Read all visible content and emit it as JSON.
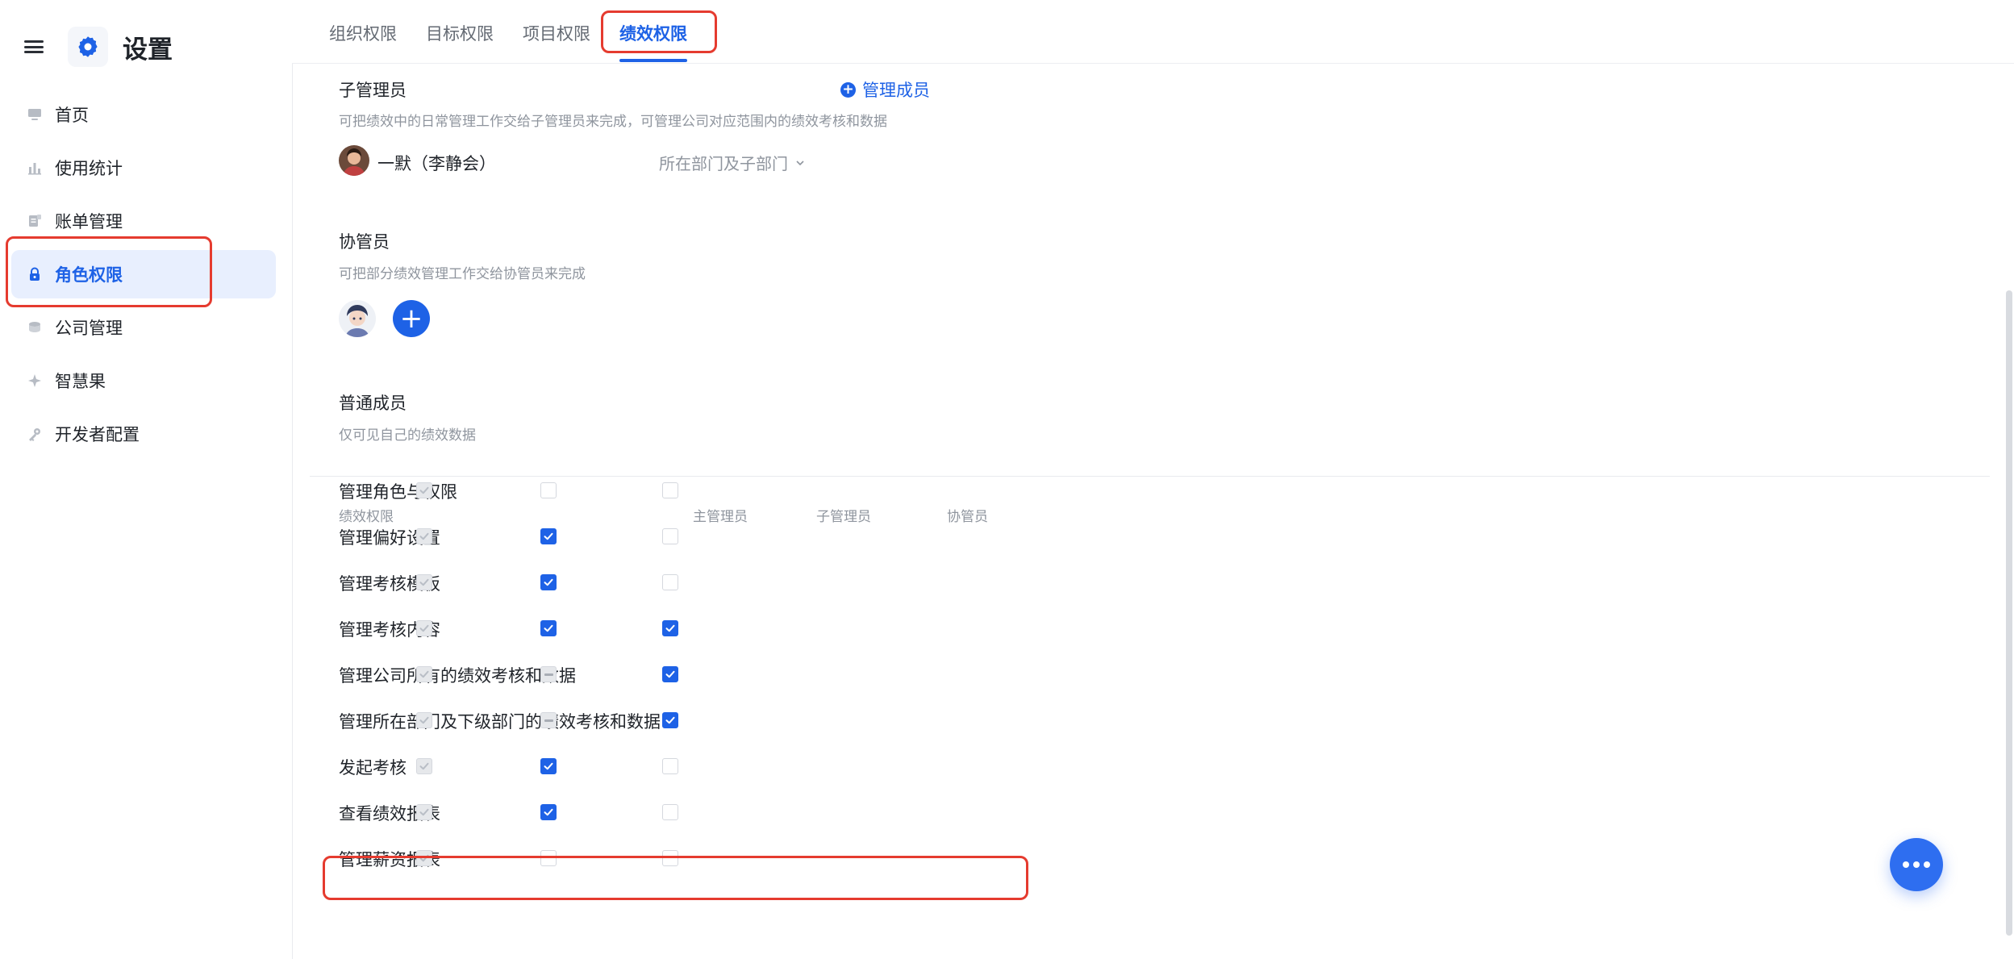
{
  "sidebar": {
    "title": "设置",
    "items": [
      {
        "label": "首页",
        "icon": "monitor-icon"
      },
      {
        "label": "使用统计",
        "icon": "bar-chart-icon"
      },
      {
        "label": "账单管理",
        "icon": "bill-icon"
      },
      {
        "label": "角色权限",
        "icon": "lock-icon",
        "active": true
      },
      {
        "label": "公司管理",
        "icon": "company-icon"
      },
      {
        "label": "智慧果",
        "icon": "sparkle-icon"
      },
      {
        "label": "开发者配置",
        "icon": "key-icon"
      }
    ]
  },
  "tabs": [
    {
      "label": "组织权限"
    },
    {
      "label": "目标权限"
    },
    {
      "label": "项目权限"
    },
    {
      "label": "绩效权限",
      "active": true
    }
  ],
  "sub_admin": {
    "title": "子管理员",
    "manage_label": "管理成员",
    "desc": "可把绩效中的日常管理工作交给子管理员来完成，可管理公司对应范围内的绩效考核和数据",
    "member_name": "一默（李静会）",
    "scope": "所在部门及子部门"
  },
  "co_admin": {
    "title": "协管员",
    "desc": "可把部分绩效管理工作交给协管员来完成"
  },
  "normal_member": {
    "title": "普通成员",
    "desc": "仅可见自己的绩效数据"
  },
  "permissions": {
    "headers": {
      "name": "绩效权限",
      "main": "主管理员",
      "sub": "子管理员",
      "co": "协管员"
    },
    "rows": [
      {
        "label": "管理角色与权限",
        "main": "disabled",
        "sub": "empty",
        "co": "empty"
      },
      {
        "label": "管理偏好设置",
        "main": "disabled",
        "sub": "checked",
        "co": "empty"
      },
      {
        "label": "管理考核模板",
        "main": "disabled",
        "sub": "checked",
        "co": "empty"
      },
      {
        "label": "管理考核内容",
        "main": "disabled",
        "sub": "checked",
        "co": "checked"
      },
      {
        "label": "管理公司所有的绩效考核和数据",
        "main": "disabled",
        "sub": "partial",
        "co": "checked"
      },
      {
        "label": "管理所在部门及下级部门的绩效考核和数据",
        "main": "disabled",
        "sub": "partial",
        "co": "checked"
      },
      {
        "label": "发起考核",
        "main": "disabled",
        "sub": "checked",
        "co": "empty"
      },
      {
        "label": "查看绩效报表",
        "main": "disabled",
        "sub": "checked",
        "co": "empty"
      },
      {
        "label": "管理薪资报表",
        "main": "disabled",
        "sub": "empty",
        "co": "empty"
      }
    ]
  },
  "colors": {
    "accent": "#1e62e6",
    "highlight": "#e53b2f"
  }
}
